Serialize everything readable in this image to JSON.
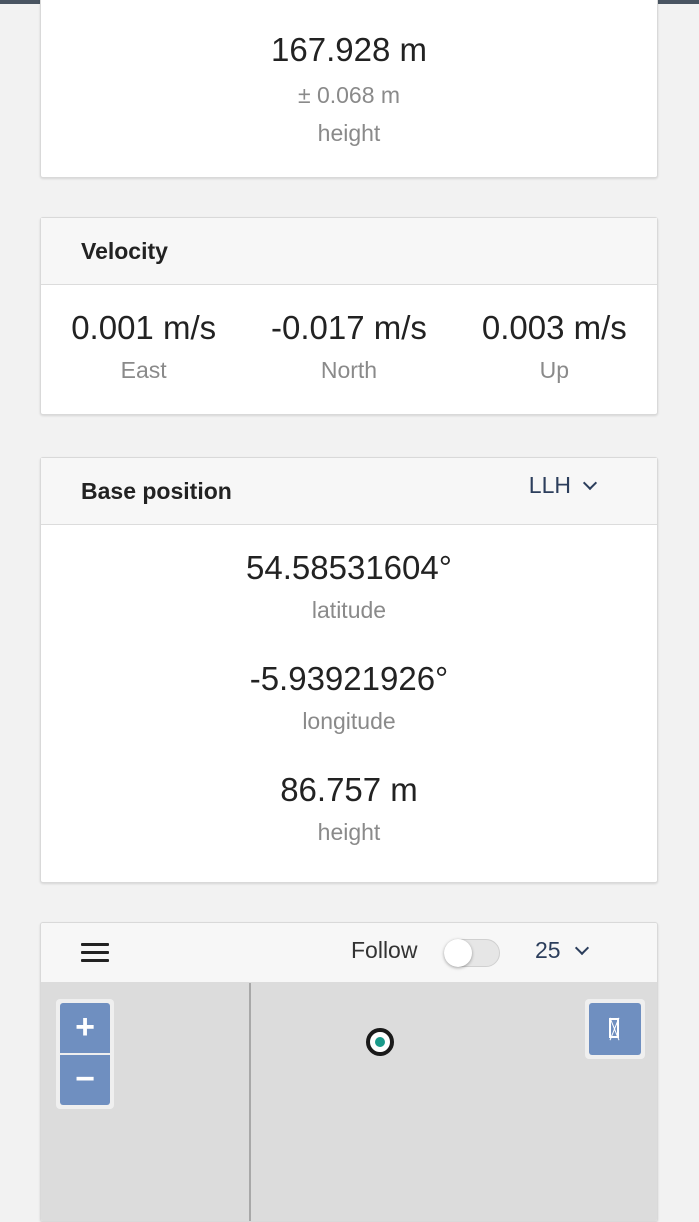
{
  "rover_height": {
    "value": "167.928 m",
    "accuracy": "± 0.068 m",
    "label": "height"
  },
  "velocity": {
    "title": "Velocity",
    "items": [
      {
        "value": "0.001 m/s",
        "label": "East"
      },
      {
        "value": "-0.017 m/s",
        "label": "North"
      },
      {
        "value": "0.003 m/s",
        "label": "Up"
      }
    ]
  },
  "base_position": {
    "title": "Base position",
    "format_select": "LLH",
    "items": [
      {
        "value": "54.58531604°",
        "label": "latitude"
      },
      {
        "value": "-5.93921926°",
        "label": "longitude"
      },
      {
        "value": "86.757 m",
        "label": "height"
      }
    ]
  },
  "map": {
    "follow_label": "Follow",
    "follow_enabled": false,
    "zoom_select": "25",
    "zoom_in_label": "+",
    "zoom_out_label": "−",
    "icons": {
      "menu": "hamburger-menu-icon",
      "fullscreen": "fullscreen-icon",
      "marker": "position-marker-icon"
    },
    "colors": {
      "control_blue": "#6f8fc0",
      "marker_teal": "#1a9a8a"
    }
  }
}
